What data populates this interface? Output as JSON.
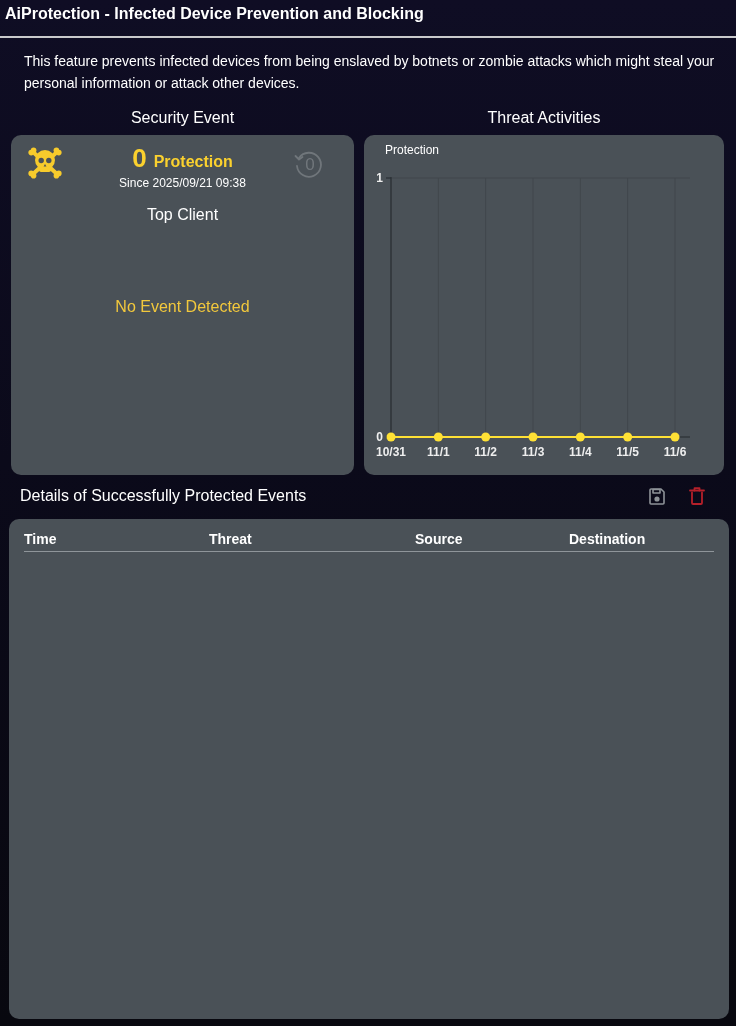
{
  "header": {
    "title": "AiProtection - Infected Device Prevention and Blocking",
    "description": "This feature prevents infected devices from being enslaved by botnets or zombie attacks which might steal your personal information or attack other devices."
  },
  "security_event": {
    "heading": "Security Event",
    "count": "0",
    "count_label": "Protection",
    "since": "Since 2025/09/21 09:38",
    "reset_count": "0",
    "top_client_heading": "Top Client",
    "empty_message": "No Event Detected"
  },
  "threat_activities": {
    "heading": "Threat Activities",
    "chart_data": {
      "type": "line",
      "categories": [
        "10/31",
        "11/1",
        "11/2",
        "11/3",
        "11/4",
        "11/5",
        "11/6"
      ],
      "series": [
        {
          "name": "Protection",
          "color": "#ffe135",
          "marker": true,
          "values": [
            0,
            0,
            0,
            0,
            0,
            0,
            0
          ]
        }
      ],
      "ylim": [
        0,
        1
      ],
      "yticks": [
        0,
        1
      ],
      "grid": true
    }
  },
  "events": {
    "title": "Details of Successfully Protected Events",
    "table": {
      "columns": [
        "Time",
        "Threat",
        "Source",
        "Destination"
      ]
    }
  }
}
